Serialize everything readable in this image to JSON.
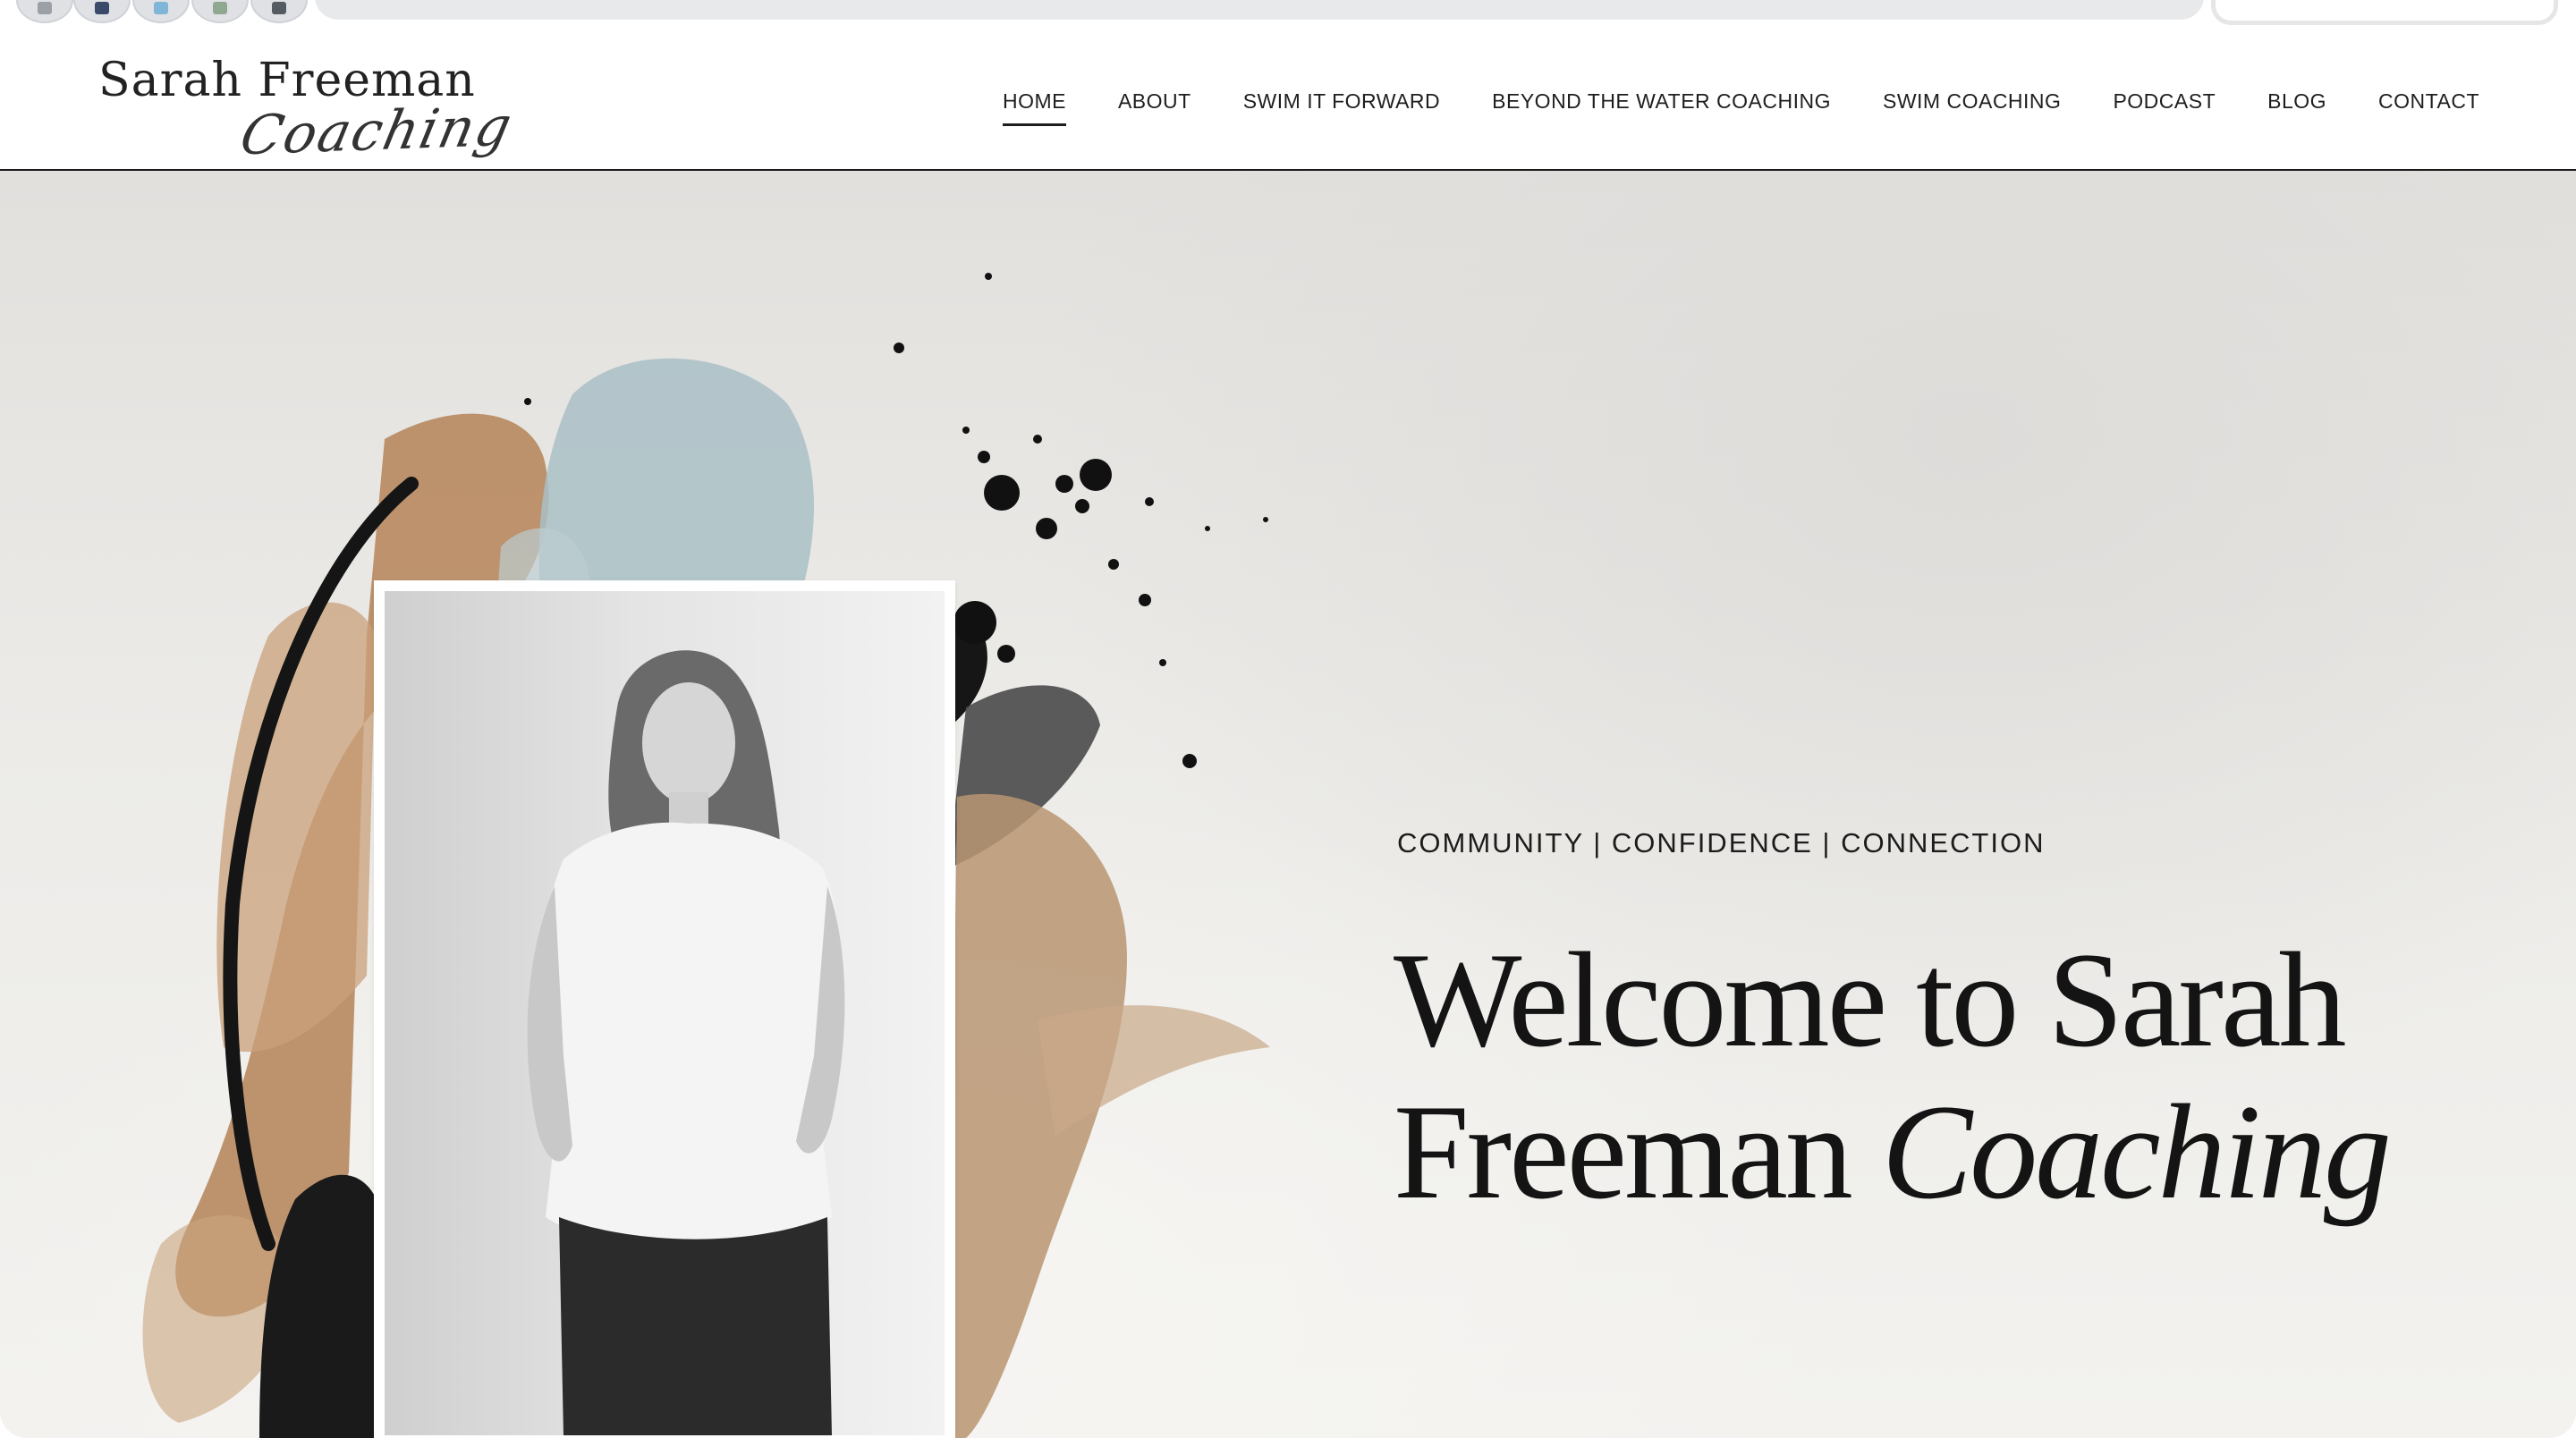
{
  "logo": {
    "name": "Sarah Freeman",
    "script": "Coaching"
  },
  "nav": {
    "items": [
      {
        "label": "HOME",
        "active": true
      },
      {
        "label": "ABOUT"
      },
      {
        "label": "SWIM IT FORWARD"
      },
      {
        "label": "BEYOND THE WATER COACHING"
      },
      {
        "label": "SWIM COACHING"
      },
      {
        "label": "PODCAST"
      },
      {
        "label": "BLOG"
      },
      {
        "label": "CONTACT"
      }
    ]
  },
  "hero": {
    "tagline": "COMMUNITY | CONFIDENCE | CONNECTION",
    "headline_line1": "Welcome to Sarah",
    "headline_line2": "Freeman",
    "headline_italic": "Coaching"
  },
  "colors": {
    "paint_tan": "#b98b63",
    "paint_blue": "#a9bfc6",
    "paint_black": "#161616",
    "text": "#141414"
  }
}
